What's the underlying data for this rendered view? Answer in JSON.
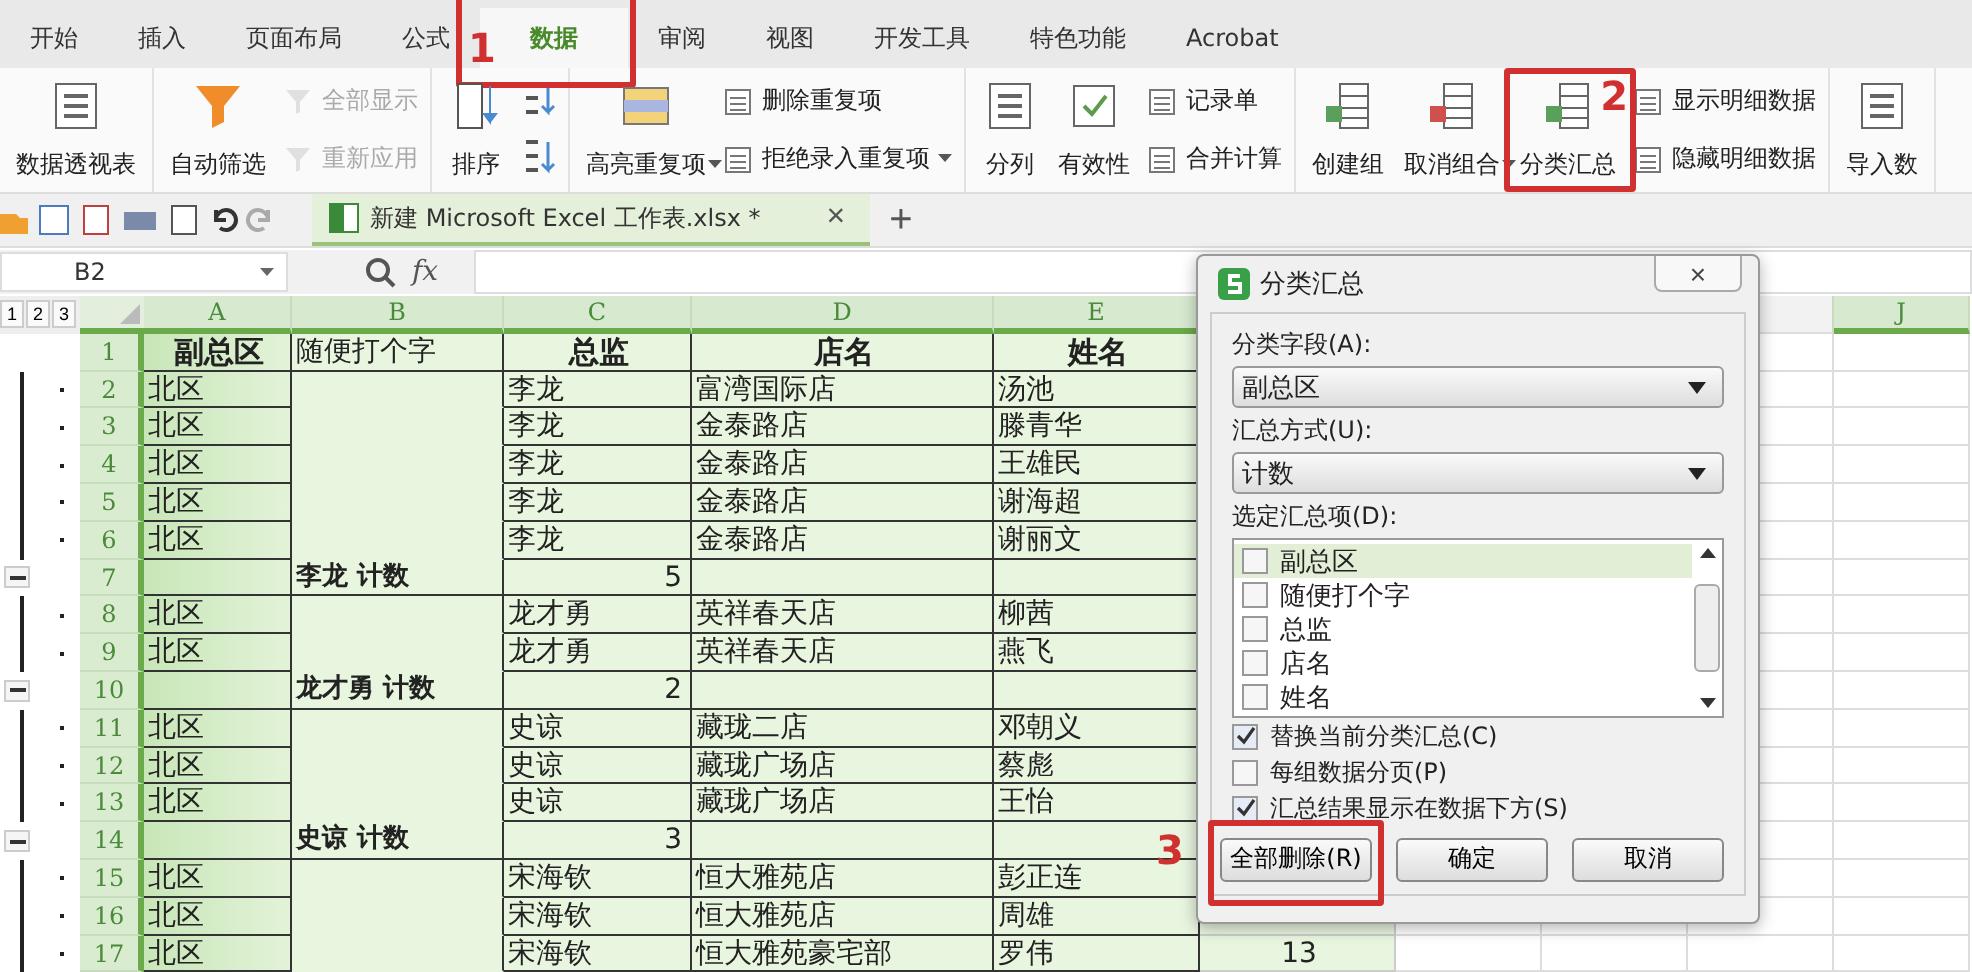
{
  "tabs": [
    {
      "label": "开始",
      "selected": false
    },
    {
      "label": "插入",
      "selected": false
    },
    {
      "label": "页面布局",
      "selected": false
    },
    {
      "label": "公式",
      "selected": false
    },
    {
      "label": "数据",
      "selected": true,
      "callout": "1"
    },
    {
      "label": "审阅",
      "selected": false
    },
    {
      "label": "视图",
      "selected": false
    },
    {
      "label": "开发工具",
      "selected": false
    },
    {
      "label": "特色功能",
      "selected": false
    },
    {
      "label": "Acrobat",
      "selected": false
    }
  ],
  "ribbon": [
    {
      "buttons": [
        {
          "kind": "large",
          "label": "数据透视表",
          "disabled": false
        }
      ]
    },
    {
      "buttons": [
        {
          "kind": "large",
          "label": "自动筛选",
          "disabled": false
        },
        {
          "kind": "small",
          "label": "全部显示",
          "disabled": true
        },
        {
          "kind": "small",
          "label": "重新应用",
          "disabled": true
        }
      ]
    },
    {
      "buttons": [
        {
          "kind": "tiny",
          "disabled": false
        },
        {
          "kind": "tiny",
          "disabled": false
        },
        {
          "kind": "large",
          "label": "排序",
          "disabled": false
        }
      ]
    },
    {
      "buttons": [
        {
          "kind": "large",
          "label": "高亮重复项",
          "disabled": false,
          "menu": true
        },
        {
          "kind": "small",
          "label": "删除重复项",
          "disabled": false
        },
        {
          "kind": "small",
          "label": "拒绝录入重复项",
          "disabled": false,
          "menu": true
        }
      ]
    },
    {
      "buttons": [
        {
          "kind": "large",
          "label": "分列",
          "disabled": false
        },
        {
          "kind": "large",
          "label": "有效性",
          "disabled": false
        },
        {
          "kind": "small",
          "label": "记录单",
          "disabled": false
        },
        {
          "kind": "small",
          "label": "合并计算",
          "disabled": false
        }
      ]
    },
    {
      "buttons": [
        {
          "kind": "large",
          "label": "创建组",
          "disabled": false
        },
        {
          "kind": "large",
          "label": "取消组合",
          "disabled": false,
          "menu": true
        },
        {
          "kind": "large",
          "label": "分类汇总",
          "disabled": false,
          "callout": "2"
        },
        {
          "kind": "small",
          "label": "显示明细数据",
          "disabled": false
        },
        {
          "kind": "small",
          "label": "隐藏明细数据",
          "disabled": false
        }
      ]
    },
    {
      "buttons": [
        {
          "kind": "large",
          "label": "导入数",
          "disabled": false
        }
      ]
    }
  ],
  "document_tab": {
    "title": "新建 Microsoft Excel 工作表.xlsx *",
    "close": "×",
    "new_tab": "+"
  },
  "formula_bar": {
    "name_box": "B2",
    "fx": "fx"
  },
  "outline_levels": [
    "1",
    "2",
    "3"
  ],
  "columns": [
    "A",
    "B",
    "C",
    "D",
    "E"
  ],
  "last_column": "J",
  "rows": [
    {
      "num": "1",
      "kind": "header",
      "a": "副总区",
      "b": "随便打个字",
      "c": "总监",
      "d": "店名",
      "e": "姓名"
    },
    {
      "num": "2",
      "kind": "data",
      "a": "北区",
      "c": "李龙",
      "d": "富湾国际店",
      "e": "汤池"
    },
    {
      "num": "3",
      "kind": "data",
      "a": "北区",
      "c": "李龙",
      "d": "金泰路店",
      "e": "滕青华"
    },
    {
      "num": "4",
      "kind": "data",
      "a": "北区",
      "c": "李龙",
      "d": "金泰路店",
      "e": "王雄民"
    },
    {
      "num": "5",
      "kind": "data",
      "a": "北区",
      "c": "李龙",
      "d": "金泰路店",
      "e": "谢海超"
    },
    {
      "num": "6",
      "kind": "data",
      "a": "北区",
      "c": "李龙",
      "d": "金泰路店",
      "e": "谢丽文"
    },
    {
      "num": "7",
      "kind": "subtotal",
      "b": "李龙  计数",
      "c": "5"
    },
    {
      "num": "8",
      "kind": "data",
      "a": "北区",
      "c": "龙才勇",
      "d": "英祥春天店",
      "e": "柳茜"
    },
    {
      "num": "9",
      "kind": "data",
      "a": "北区",
      "c": "龙才勇",
      "d": "英祥春天店",
      "e": "燕飞"
    },
    {
      "num": "10",
      "kind": "subtotal",
      "b": "龙才勇  计数",
      "c": "2"
    },
    {
      "num": "11",
      "kind": "data",
      "a": "北区",
      "c": "史谅",
      "d": "藏珑二店",
      "e": "邓朝义"
    },
    {
      "num": "12",
      "kind": "data",
      "a": "北区",
      "c": "史谅",
      "d": "藏珑广场店",
      "e": "蔡彪"
    },
    {
      "num": "13",
      "kind": "data",
      "a": "北区",
      "c": "史谅",
      "d": "藏珑广场店",
      "e": "王怡"
    },
    {
      "num": "14",
      "kind": "subtotal",
      "b": "史谅  计数",
      "c": "3"
    },
    {
      "num": "15",
      "kind": "data",
      "a": "北区",
      "c": "宋海钦",
      "d": "恒大雅苑店",
      "e": "彭正连"
    },
    {
      "num": "16",
      "kind": "data",
      "a": "北区",
      "c": "宋海钦",
      "d": "恒大雅苑店",
      "e": "周雄"
    },
    {
      "num": "17",
      "kind": "data",
      "a": "北区",
      "c": "宋海钦",
      "d": "恒大雅苑豪宅部",
      "e": "罗伟",
      "f": "13"
    }
  ],
  "dialog": {
    "title": "分类汇总",
    "close": "×",
    "field_label": "分类字段(A):",
    "field_value": "副总区",
    "method_label": "汇总方式(U):",
    "method_value": "计数",
    "items_label": "选定汇总项(D):",
    "items": [
      {
        "label": "副总区",
        "checked": false,
        "selected": true
      },
      {
        "label": "随便打个字",
        "checked": false,
        "selected": false
      },
      {
        "label": "总监",
        "checked": false,
        "selected": false
      },
      {
        "label": "店名",
        "checked": false,
        "selected": false
      },
      {
        "label": "姓名",
        "checked": false,
        "selected": false
      }
    ],
    "options": [
      {
        "label": "替换当前分类汇总(C)",
        "checked": true
      },
      {
        "label": "每组数据分页(P)",
        "checked": false
      },
      {
        "label": "汇总结果显示在数据下方(S)",
        "checked": true
      }
    ],
    "buttons": [
      {
        "label": "全部删除(R)",
        "callout": "3"
      },
      {
        "label": "确定"
      },
      {
        "label": "取消"
      }
    ]
  }
}
